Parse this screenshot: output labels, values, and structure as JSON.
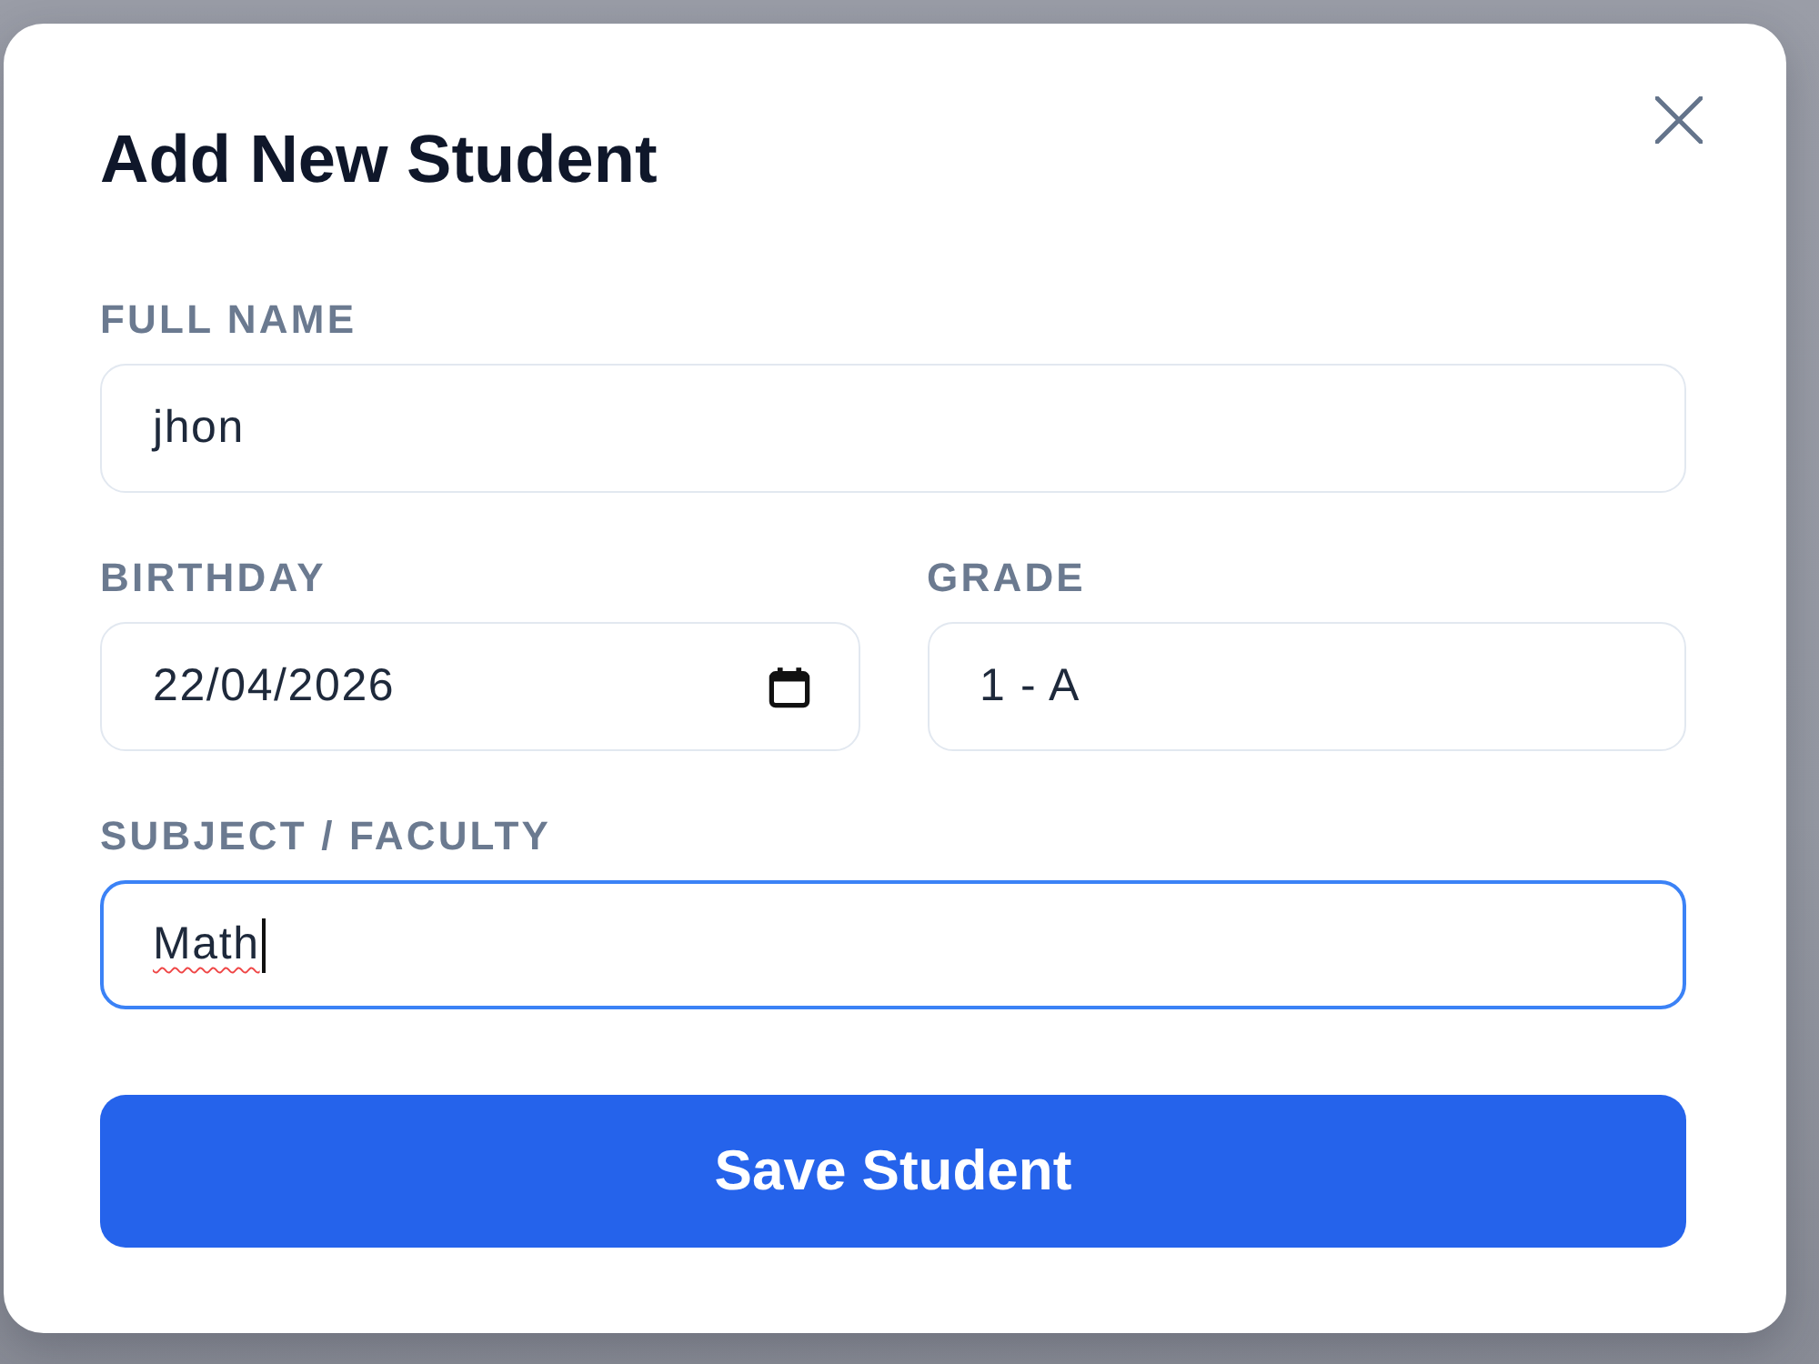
{
  "dialog": {
    "title": "Add New Student"
  },
  "form": {
    "rows": [
      [
        {
          "label": "FULL NAME",
          "value": "jhon",
          "kind": "text",
          "focused": false,
          "misspelled": false
        }
      ],
      [
        {
          "label": "BIRTHDAY",
          "value": "22/04/2026",
          "kind": "date",
          "focused": false,
          "misspelled": false
        },
        {
          "label": "GRADE",
          "value": "1 - A",
          "kind": "text",
          "focused": false,
          "misspelled": false
        }
      ],
      [
        {
          "label": "SUBJECT / FACULTY",
          "value": "Math",
          "kind": "text",
          "focused": true,
          "misspelled": true
        }
      ]
    ]
  },
  "submit_button": {
    "label": "Save Student"
  }
}
